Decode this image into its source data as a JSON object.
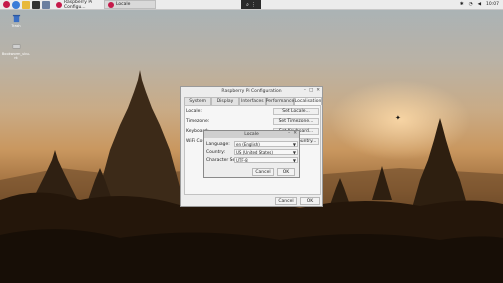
{
  "taskbar": {
    "tasks": [
      {
        "label": "Raspberry Pi Configu..."
      },
      {
        "label": "Locale"
      }
    ],
    "clock": "10:07"
  },
  "desktop": {
    "icons": [
      {
        "label": "Trash"
      },
      {
        "label": "Bookworm_ubu-nt"
      }
    ]
  },
  "config_window": {
    "title": "Raspberry Pi Configuration",
    "tabs": [
      "System",
      "Display",
      "Interfaces",
      "Performance",
      "Localisation"
    ],
    "active_tab": "Localisation",
    "rows": [
      {
        "label": "Locale:",
        "button": "Set Locale..."
      },
      {
        "label": "Timezone:",
        "button": "Set Timezone..."
      },
      {
        "label": "Keyboard:",
        "button": "Set Keyboard..."
      },
      {
        "label": "WiFi Country:",
        "button": "Set WiFi Country..."
      }
    ],
    "cancel_label": "Cancel",
    "ok_label": "OK"
  },
  "locale_dialog": {
    "title": "Locale",
    "fields": [
      {
        "label": "Language:",
        "value": "en (English)"
      },
      {
        "label": "Country:",
        "value": "US (United States)"
      },
      {
        "label": "Character Set:",
        "value": "UTF-8"
      }
    ],
    "cancel_label": "Cancel",
    "ok_label": "OK"
  }
}
